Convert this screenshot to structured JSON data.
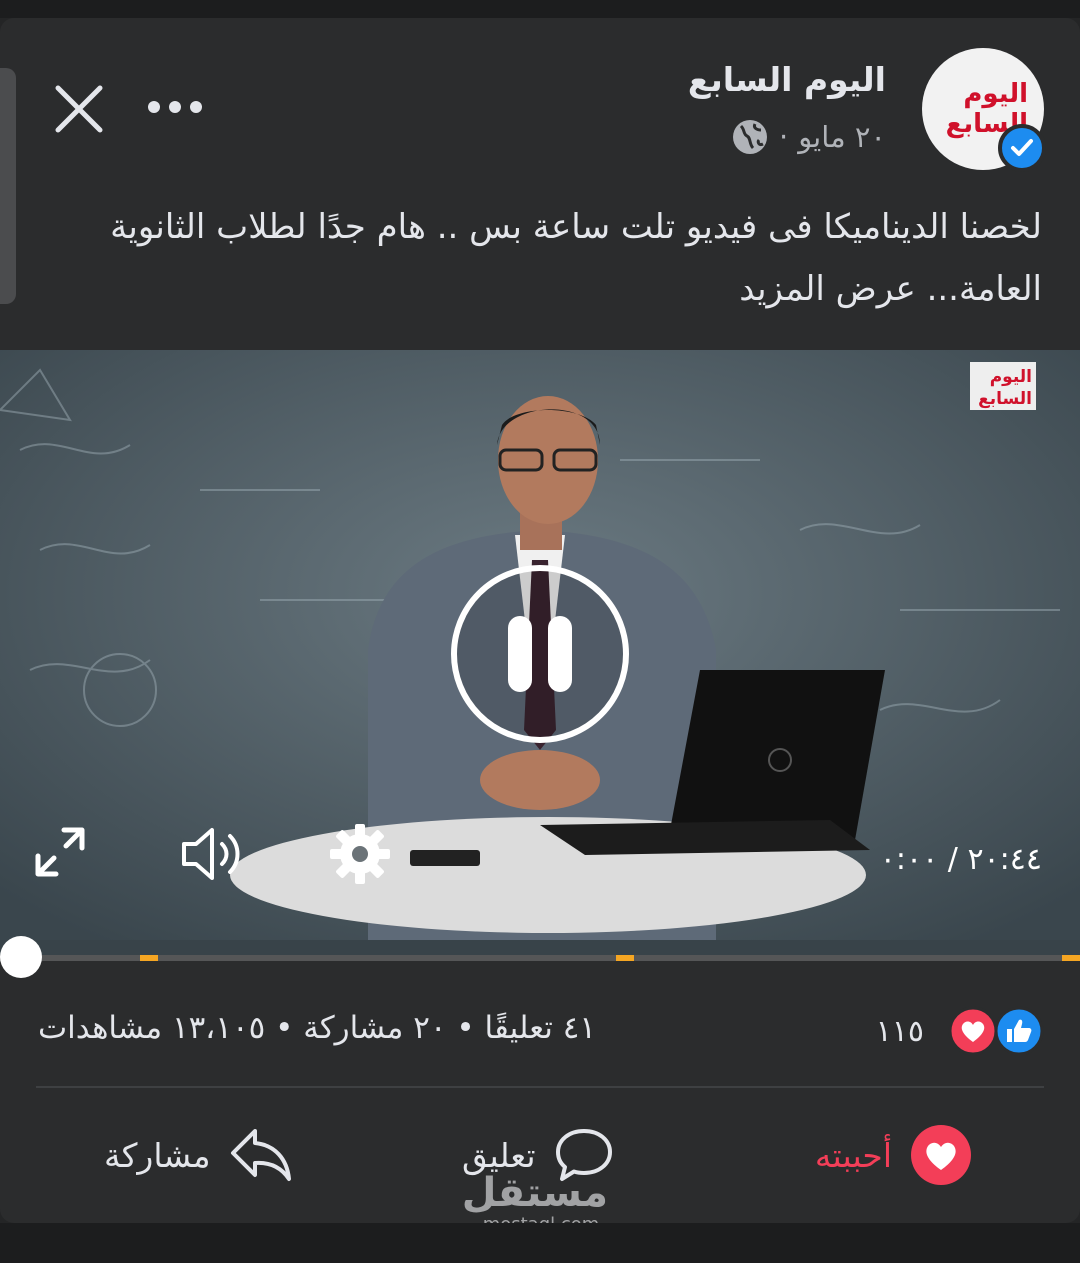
{
  "post": {
    "page_name": "اليوم السابع",
    "date": "٢٠ مايو",
    "separator": "·",
    "caption": "لخصنا الديناميكا فى فيديو تلت ساعة بس .. هام جدًا لطلاب الثانوية العامة...",
    "see_more": "عرض المزيد",
    "logo_text_line1": "اليوم",
    "logo_text_line2": "السابع"
  },
  "video": {
    "time_current": "٠:٠٠",
    "time_separator": "/",
    "time_total": "٢٠:٤٤",
    "progress_fraction": 0.0,
    "state": "playing"
  },
  "stats": {
    "reaction_count": "١١٥",
    "comments": "٤١ تعليقًا",
    "shares": "٢٠ مشاركة",
    "views": "١٣،١٠٥ مشاهدات",
    "dot": "•"
  },
  "actions": {
    "like": "أحببته",
    "comment": "تعليق",
    "share": "مشاركة"
  },
  "watermark": {
    "arabic": "مستقل",
    "latin": "mostaql.com"
  },
  "colors": {
    "love": "#f33e58",
    "like_blue": "#1d8cf0",
    "background": "#242526",
    "card": "#2b2c2d",
    "progress_marker": "#f5a623"
  },
  "icons": [
    "close-icon",
    "more-icon",
    "globe-icon",
    "verified-icon",
    "pause-icon",
    "fullscreen-icon",
    "volume-icon",
    "settings-icon",
    "like-reaction-icon",
    "love-reaction-icon",
    "heart-icon",
    "comment-icon",
    "share-icon"
  ]
}
